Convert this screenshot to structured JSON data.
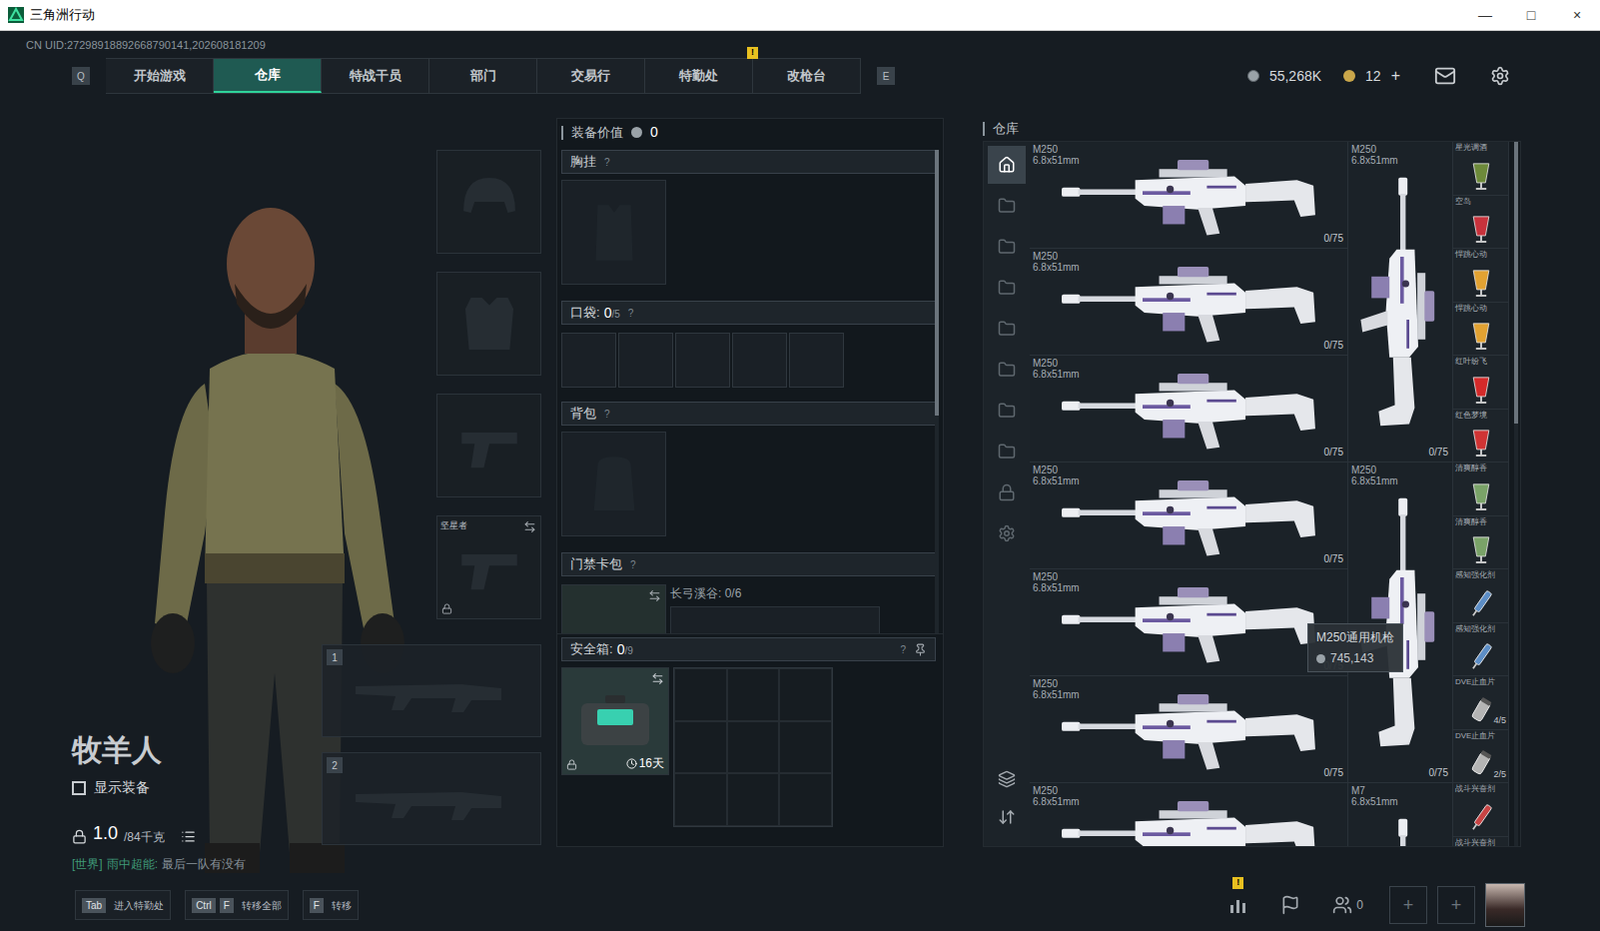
{
  "window": {
    "title": "三角洲行动",
    "controls": [
      "—",
      "□",
      "×"
    ]
  },
  "uid": "CN UID:27298918892668790141,202608181209",
  "nav": {
    "prev_key": "Q",
    "next_key": "E",
    "alert_text": "!",
    "tabs": [
      {
        "label": "开始游戏",
        "selected": false,
        "alert": false
      },
      {
        "label": "仓库",
        "selected": true,
        "alert": false
      },
      {
        "label": "特战干员",
        "selected": false,
        "alert": false
      },
      {
        "label": "部门",
        "selected": false,
        "alert": false
      },
      {
        "label": "交易行",
        "selected": false,
        "alert": false
      },
      {
        "label": "特勤处",
        "selected": false,
        "alert": true
      },
      {
        "label": "改枪台",
        "selected": false,
        "alert": false
      }
    ]
  },
  "currency": {
    "coins": "55,268K",
    "tokens": "12",
    "add": "+"
  },
  "operator": {
    "name": "牧羊人",
    "show_gear": {
      "label": "显示装备",
      "checked": false
    },
    "weight": "1.0",
    "weight_max": "/84千克",
    "locked": true
  },
  "chat": {
    "channel": "[世界]",
    "sender": "雨中超能:",
    "message": "最后一队有没有"
  },
  "gear_slots": [
    {
      "kind": "helmet"
    },
    {
      "kind": "armor"
    },
    {
      "kind": "pistol"
    },
    {
      "kind": "melee",
      "label": "坚星者",
      "locked": true
    }
  ],
  "weapon_slots": [
    {
      "number": "1"
    },
    {
      "number": "2"
    }
  ],
  "loadout": {
    "value_label": "装备价值",
    "value": "0",
    "scroll_level": 0.55,
    "chest_rig": {
      "label": "胸挂",
      "help": "?"
    },
    "pockets": {
      "label": "口袋:",
      "count": "0",
      "max": "/5",
      "help": "?",
      "slots": 5
    },
    "backpack": {
      "label": "背包",
      "help": "?"
    },
    "keycard": {
      "label": "门禁卡包",
      "help": "?",
      "card": "长弓溪谷: 0/6"
    },
    "safe_box": {
      "label": "安全箱:",
      "count": "0",
      "max": "/9",
      "help": "?",
      "timer": "16天",
      "locked": true,
      "grid_cells": 9
    }
  },
  "warehouse": {
    "title": "仓库",
    "scroll_level": 0.4,
    "sidebar": [
      {
        "kind": "all",
        "selected": true
      },
      {
        "kind": "tab",
        "selected": false
      },
      {
        "kind": "tab",
        "selected": false
      },
      {
        "kind": "tab",
        "selected": false
      },
      {
        "kind": "tab",
        "selected": false
      },
      {
        "kind": "tab",
        "selected": false
      },
      {
        "kind": "tab",
        "selected": false
      },
      {
        "kind": "tab",
        "selected": false
      },
      {
        "kind": "locked",
        "selected": false
      },
      {
        "kind": "settings",
        "selected": false
      }
    ],
    "tools": [
      "stack",
      "sort"
    ],
    "guns": [
      {
        "name": "M250",
        "caliber": "6.8x51mm",
        "count": "0/75"
      },
      {
        "name": "M250",
        "caliber": "6.8x51mm",
        "count": "0/75"
      },
      {
        "name": "M250",
        "caliber": "6.8x51mm",
        "count": "0/75"
      },
      {
        "name": "M250",
        "caliber": "6.8x51mm",
        "count": "0/75"
      },
      {
        "name": "M250",
        "caliber": "6.8x51mm",
        "count": "0/75"
      },
      {
        "name": "M250",
        "caliber": "6.8x51mm",
        "count": "0/75"
      },
      {
        "name": "M250",
        "caliber": "6.8x51mm",
        "count": ""
      }
    ],
    "tall_guns": [
      {
        "name": "M250",
        "caliber": "6.8x51mm",
        "count": "0/75"
      },
      {
        "name": "M250",
        "caliber": "6.8x51mm",
        "count": "0/75"
      },
      {
        "name": "M7",
        "caliber": "6.8x51mm",
        "count": ""
      }
    ],
    "consumables": [
      {
        "name": "星光调酒",
        "kind": "drink",
        "color": "#6d8a3a",
        "count": ""
      },
      {
        "name": "空岛",
        "kind": "drink",
        "color": "#c8323c",
        "count": ""
      },
      {
        "name": "悍跳心动",
        "kind": "drink",
        "color": "#e2a232",
        "count": ""
      },
      {
        "name": "悍跳心动",
        "kind": "drink",
        "color": "#e2a232",
        "count": ""
      },
      {
        "name": "红叶纷飞",
        "kind": "drink",
        "color": "#d42a2a",
        "count": ""
      },
      {
        "name": "红色梦境",
        "kind": "drink",
        "color": "#d03434",
        "count": ""
      },
      {
        "name": "清爽醇香",
        "kind": "drink",
        "color": "#7aa368",
        "count": ""
      },
      {
        "name": "清爽醇香",
        "kind": "drink",
        "color": "#7aa368",
        "count": ""
      },
      {
        "name": "感知强化剂",
        "kind": "injector",
        "color": "#5d8ec6",
        "count": ""
      },
      {
        "name": "感知强化剂",
        "kind": "injector",
        "color": "#5d8ec6",
        "count": ""
      },
      {
        "name": "DVE止血片",
        "kind": "canister",
        "color": "#b4b4b4",
        "count": "4/5"
      },
      {
        "name": "DVE止血片",
        "kind": "canister",
        "color": "#b4b4b4",
        "count": "2/5"
      },
      {
        "name": "战斗兴奋剂",
        "kind": "injector",
        "color": "#c84444",
        "count": ""
      },
      {
        "name": "战斗兴奋剂",
        "kind": "injector",
        "color": "#c84444",
        "count": ""
      }
    ],
    "tooltip": {
      "name": "M250通用机枪",
      "price": "745,143"
    }
  },
  "bottom_bar": {
    "hints": [
      {
        "keys": [
          "Tab"
        ],
        "label": "进入特勤处"
      },
      {
        "keys": [
          "Ctrl",
          "F"
        ],
        "label": "转移全部"
      },
      {
        "keys": [
          "F"
        ],
        "label": "转移"
      }
    ],
    "stats_alert": true,
    "friends": "0",
    "party_slots": [
      "+",
      "+"
    ]
  }
}
